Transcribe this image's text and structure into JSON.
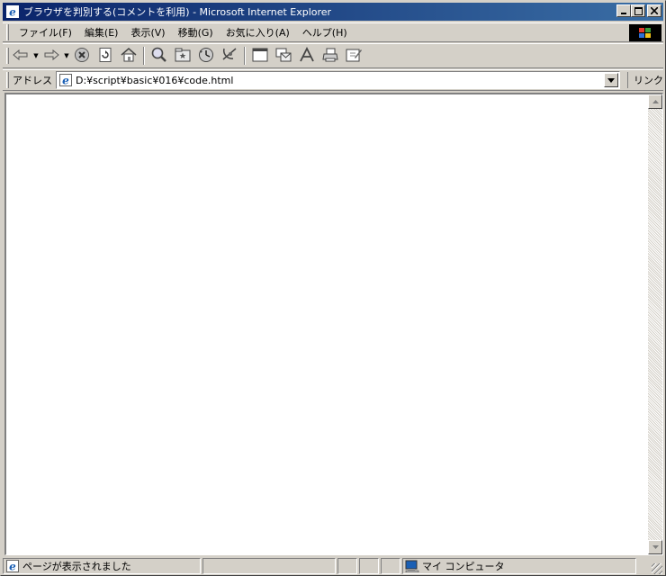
{
  "window": {
    "title": "ブラウザを判別する(コメントを利用) - Microsoft Internet Explorer",
    "buttons": {
      "minimize": "_",
      "maximize": "□",
      "close": "×"
    }
  },
  "menu": {
    "items": [
      {
        "label": "ファイル(F)"
      },
      {
        "label": "編集(E)"
      },
      {
        "label": "表示(V)"
      },
      {
        "label": "移動(G)"
      },
      {
        "label": "お気に入り(A)"
      },
      {
        "label": "ヘルプ(H)"
      }
    ]
  },
  "toolbar": {
    "buttons": [
      "back-icon",
      "forward-icon",
      "stop-icon",
      "refresh-icon",
      "home-icon",
      "search-icon",
      "favorites-icon",
      "history-icon",
      "channels-icon",
      "fullscreen-icon",
      "mail-icon",
      "font-icon",
      "print-icon",
      "edit-icon"
    ]
  },
  "address": {
    "label": "アドレス",
    "value": "D:¥script¥basic¥016¥code.html",
    "links_label": "リンク"
  },
  "status": {
    "text": "ページが表示されました",
    "zone": "マイ コンピュータ"
  },
  "colors": {
    "title_gradient_start": "#0a246a",
    "title_gradient_end": "#3a6ea5",
    "chrome": "#d4d0c8"
  }
}
